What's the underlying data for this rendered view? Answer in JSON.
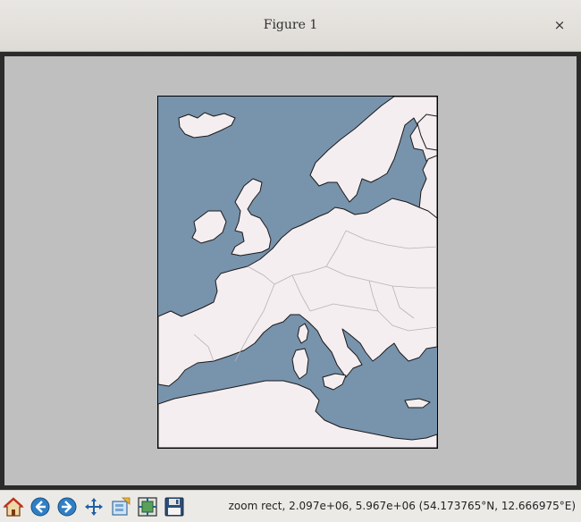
{
  "window": {
    "title": "Figure 1",
    "close_glyph": "×"
  },
  "map": {
    "ocean_color": "#7893ac",
    "land_color": "#f5eef0",
    "border_color": "#b9b2b4"
  },
  "toolbar": {
    "buttons": [
      {
        "name": "home-button",
        "icon": "home-icon"
      },
      {
        "name": "back-button",
        "icon": "arrow-left-icon"
      },
      {
        "name": "forward-button",
        "icon": "arrow-right-icon"
      },
      {
        "name": "pan-button",
        "icon": "pan-icon"
      },
      {
        "name": "zoom-button",
        "icon": "zoom-rect-icon"
      },
      {
        "name": "subplots-button",
        "icon": "subplots-icon"
      },
      {
        "name": "save-button",
        "icon": "floppy-icon"
      }
    ]
  },
  "status": {
    "text": "zoom rect, 2.097e+06, 5.967e+06 (54.173765°N, 12.666975°E)"
  }
}
